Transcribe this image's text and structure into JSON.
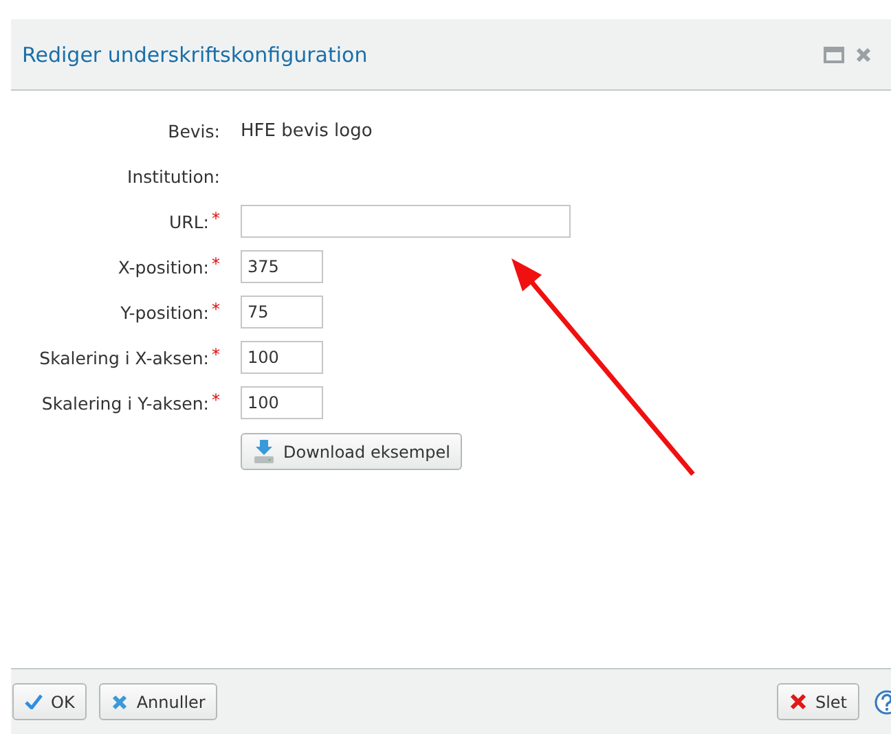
{
  "dialog": {
    "title": "Rediger underskriftskonfiguration"
  },
  "fields": [
    {
      "label": "Bevis:",
      "kind": "text",
      "value": "HFE bevis logo",
      "required": false
    },
    {
      "label": "Institution:",
      "kind": "text",
      "required": false
    },
    {
      "label": "URL:",
      "kind": "input",
      "required": true,
      "wide": true
    },
    {
      "label": "X-position:",
      "kind": "input",
      "value": "375",
      "required": true,
      "wide": false
    },
    {
      "label": "Y-position:",
      "kind": "input",
      "value": "75",
      "required": true,
      "wide": false
    },
    {
      "label": "Skalering i X-aksen:",
      "kind": "input",
      "value": "100",
      "required": true,
      "wide": false
    },
    {
      "label": "Skalering i Y-aksen:",
      "kind": "input",
      "value": "100",
      "required": true,
      "wide": false
    }
  ],
  "required_mark": "*",
  "download_button": "Download eksempel",
  "footer": {
    "ok": "OK",
    "cancel": "Annuller",
    "delete": "Slet"
  }
}
